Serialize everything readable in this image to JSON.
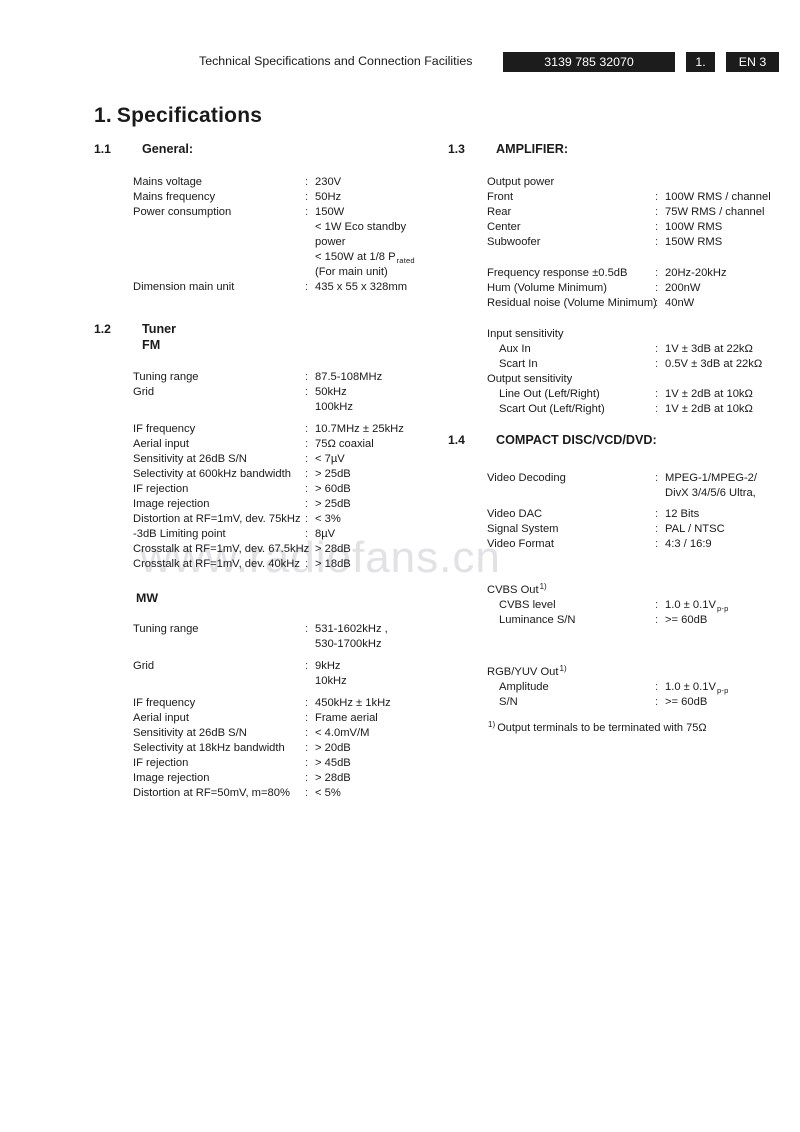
{
  "header": {
    "title": "Technical Specifications and Connection Facilities",
    "code_badge": "3139 785 32070",
    "chapter_badge": "1.",
    "language_badge": "EN 3"
  },
  "watermark": "www.radiofans.cn",
  "document": {
    "title_number": "1.",
    "title_text": "Specifications"
  },
  "sections": {
    "general": {
      "number": "1.1",
      "title": "General:",
      "rows": [
        {
          "label": "Mains voltage",
          "colon": ":",
          "value": "230V"
        },
        {
          "label": "Mains frequency",
          "colon": ":",
          "value": "50Hz"
        },
        {
          "label": "Power consumption",
          "colon": ":",
          "value": "150W"
        },
        {
          "label": "",
          "colon": "",
          "value": "< 1W Eco standby"
        },
        {
          "label": "",
          "colon": "",
          "value": "power"
        },
        {
          "label": "",
          "colon": "",
          "value": "< 150W at 1/8 P",
          "value_sub": "rated"
        },
        {
          "label": "",
          "colon": "",
          "value": "(For main unit)"
        },
        {
          "label": "Dimension main unit",
          "colon": ":",
          "value": "435 x 55 x 328mm"
        }
      ]
    },
    "tuner": {
      "number": "1.2",
      "title": "Tuner",
      "subtitle": "FM",
      "fm_rows": [
        {
          "label": "Tuning range",
          "colon": ":",
          "value": "87.5-108MHz"
        },
        {
          "label": "Grid",
          "colon": ":",
          "value": "50kHz"
        },
        {
          "label": "",
          "colon": "",
          "value": "100kHz"
        },
        {
          "label": "IF frequency",
          "colon": ":",
          "value": "10.7MHz ± 25kHz"
        },
        {
          "label": "Aerial input",
          "colon": ":",
          "value": "75Ω coaxial"
        },
        {
          "label": "Sensitivity at 26dB S/N",
          "colon": ":",
          "value": "< 7µV"
        },
        {
          "label": "Selectivity at 600kHz bandwidth",
          "colon": ":",
          "value": "> 25dB"
        },
        {
          "label": "IF rejection",
          "colon": ":",
          "value": "> 60dB"
        },
        {
          "label": "Image rejection",
          "colon": ":",
          "value": "> 25dB"
        },
        {
          "label": "Distortion at RF=1mV, dev. 75kHz",
          "colon": ":",
          "value": "< 3%"
        },
        {
          "label": "-3dB Limiting point",
          "colon": ":",
          "value": "8µV"
        },
        {
          "label": "Crosstalk at RF=1mV, dev. 67.5kHz",
          "colon": ":",
          "value": "> 28dB"
        },
        {
          "label": "Crosstalk at RF=1mV, dev. 40kHz",
          "colon": ":",
          "value": "> 18dB"
        }
      ],
      "mw_heading": "MW",
      "mw_rows": [
        {
          "label": "Tuning range",
          "colon": ":",
          "value": "531-1602kHz ,"
        },
        {
          "label": "",
          "colon": "",
          "value": "530-1700kHz"
        },
        {
          "label": "Grid",
          "colon": ":",
          "value": "9kHz"
        },
        {
          "label": "",
          "colon": "",
          "value": "10kHz"
        },
        {
          "label": "IF frequency",
          "colon": ":",
          "value": "450kHz ± 1kHz"
        },
        {
          "label": "Aerial input",
          "colon": ":",
          "value": "Frame aerial"
        },
        {
          "label": "Sensitivity at 26dB S/N",
          "colon": ":",
          "value": "< 4.0mV/M"
        },
        {
          "label": "Selectivity at 18kHz bandwidth",
          "colon": ":",
          "value": "> 20dB"
        },
        {
          "label": "IF rejection",
          "colon": ":",
          "value": "> 45dB"
        },
        {
          "label": "Image rejection",
          "colon": ":",
          "value": "> 28dB"
        },
        {
          "label": "Distortion at RF=50mV, m=80%",
          "colon": ":",
          "value": "< 5%"
        }
      ]
    },
    "amplifier": {
      "number": "1.3",
      "title": "AMPLIFIER:",
      "rows": [
        {
          "label": "Output power",
          "colon": "",
          "value": ""
        },
        {
          "label": "Front",
          "colon": ":",
          "value": "100W RMS / channel"
        },
        {
          "label": "Rear",
          "colon": ":",
          "value": "75W RMS / channel"
        },
        {
          "label": "Center",
          "colon": ":",
          "value": "100W RMS"
        },
        {
          "label": "Subwoofer",
          "colon": ":",
          "value": "150W RMS"
        },
        {
          "label": "Frequency response ±0.5dB",
          "colon": ":",
          "value": "20Hz-20kHz"
        },
        {
          "label": "Hum (Volume Minimum)",
          "colon": ":",
          "value": "200nW"
        },
        {
          "label": "Residual noise (Volume Minimum)",
          "colon": ":",
          "value": "40nW"
        },
        {
          "label": "Input sensitivity",
          "colon": "",
          "value": ""
        },
        {
          "label": "Aux In",
          "colon": ":",
          "value": "1V ± 3dB at 22kΩ",
          "indent": true
        },
        {
          "label": "Scart In",
          "colon": ":",
          "value": "0.5V ± 3dB at 22kΩ",
          "indent": true
        },
        {
          "label": "Output sensitivity",
          "colon": "",
          "value": ""
        },
        {
          "label": "Line Out (Left/Right)",
          "colon": ":",
          "value": "1V ± 2dB at 10kΩ",
          "indent": true
        },
        {
          "label": "Scart Out (Left/Right)",
          "colon": ":",
          "value": "1V ± 2dB at 10kΩ",
          "indent": true
        }
      ]
    },
    "disc": {
      "number": "1.4",
      "title": "COMPACT DISC/VCD/DVD:",
      "rows": [
        {
          "label": "Video Decoding",
          "colon": ":",
          "value": "MPEG-1/MPEG-2/"
        },
        {
          "label": "",
          "colon": "",
          "value": "DivX 3/4/5/6 Ultra,"
        },
        {
          "label": "Video DAC",
          "colon": ":",
          "value": "12 Bits"
        },
        {
          "label": "Signal System",
          "colon": ":",
          "value": "PAL / NTSC"
        },
        {
          "label": "Video Format",
          "colon": ":",
          "value": "4:3 / 16:9"
        },
        {
          "label": "CVBS Out",
          "colon": "",
          "value": "",
          "label_sup": "1)"
        },
        {
          "label": "CVBS level",
          "colon": ":",
          "value": "1.0 ± 0.1V",
          "value_sub": "p-p",
          "indent": true
        },
        {
          "label": "Luminance S/N",
          "colon": ":",
          "value": ">= 60dB",
          "indent": true
        },
        {
          "label": "RGB/YUV Out",
          "colon": "",
          "value": "",
          "label_sup": "1)"
        },
        {
          "label": "Amplitude",
          "colon": ":",
          "value": "1.0 ± 0.1V",
          "value_sub": "p-p",
          "indent": true
        },
        {
          "label": "S/N",
          "colon": ":",
          "value": ">= 60dB",
          "indent": true
        }
      ],
      "footnote_marker": "1)",
      "footnote_text": "Output terminals to be terminated with 75Ω"
    }
  }
}
